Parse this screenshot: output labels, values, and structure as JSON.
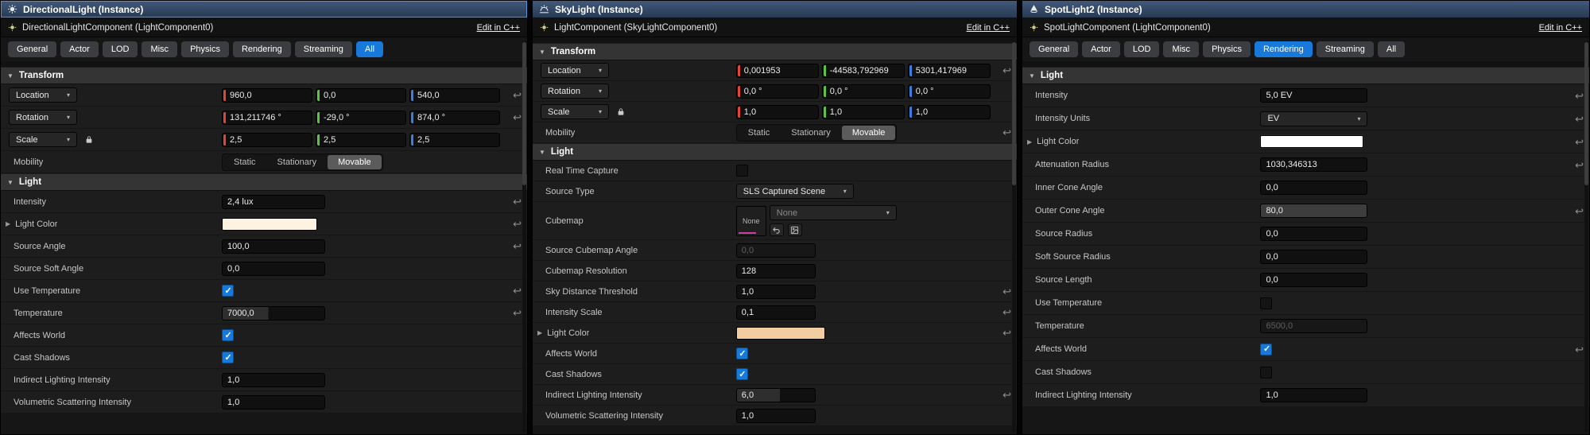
{
  "colors": {
    "accent": "#1779da",
    "axis_x": "#e0453a",
    "axis_y": "#5ec440",
    "axis_z": "#3a7ce0",
    "p1_light_color": "#fdf3e0",
    "p2_light_color": "#f2cda1",
    "p3_light_color": "#ffffff"
  },
  "icons": {
    "chevron_down": "▾",
    "section_collapse": "▼",
    "row_expand": "▶",
    "reset": "↩"
  },
  "panels": [
    {
      "title": "DirectionalLight (Instance)",
      "component": "DirectionalLightComponent (LightComponent0)",
      "edit_link": "Edit in C++",
      "tabs": [
        {
          "label": "General",
          "active": false
        },
        {
          "label": "Actor",
          "active": false
        },
        {
          "label": "LOD",
          "active": false
        },
        {
          "label": "Misc",
          "active": false
        },
        {
          "label": "Physics",
          "active": false
        },
        {
          "label": "Rendering",
          "active": false
        },
        {
          "label": "Streaming",
          "active": false
        },
        {
          "label": "All",
          "active": true
        }
      ],
      "transform_header": "Transform",
      "transform": {
        "location": {
          "label": "Location",
          "x": "960,0",
          "y": "0,0",
          "z": "540,0"
        },
        "rotation": {
          "label": "Rotation",
          "x": "131,211746 °",
          "y": "-29,0 °",
          "z": "874,0 °"
        },
        "scale": {
          "label": "Scale",
          "x": "2,5",
          "y": "2,5",
          "z": "2,5"
        },
        "mobility": {
          "label": "Mobility",
          "options": [
            {
              "label": "Static",
              "active": false
            },
            {
              "label": "Stationary",
              "active": false
            },
            {
              "label": "Movable",
              "active": true
            }
          ]
        }
      },
      "light_header": "Light",
      "light": {
        "intensity": {
          "label": "Intensity",
          "value": "2,4 lux"
        },
        "light_color": {
          "label": "Light Color"
        },
        "source_angle": {
          "label": "Source Angle",
          "value": "100,0"
        },
        "source_soft_angle": {
          "label": "Source Soft Angle",
          "value": "0,0"
        },
        "use_temperature": {
          "label": "Use Temperature",
          "checked": true
        },
        "temperature": {
          "label": "Temperature",
          "value": "7000,0"
        },
        "affects_world": {
          "label": "Affects World",
          "checked": true
        },
        "cast_shadows": {
          "label": "Cast Shadows",
          "checked": true
        },
        "indirect_lighting_intensity": {
          "label": "Indirect Lighting Intensity",
          "value": "1,0"
        },
        "volumetric_scattering_intensity": {
          "label": "Volumetric Scattering Intensity",
          "value": "1,0"
        }
      }
    },
    {
      "title": "SkyLight (Instance)",
      "component": "LightComponent (SkyLightComponent0)",
      "edit_link": "Edit in C++",
      "transform_header": "Transform",
      "transform": {
        "location": {
          "label": "Location",
          "x": "0,001953",
          "y": "-44583,792969",
          "z": "5301,417969"
        },
        "rotation": {
          "label": "Rotation",
          "x": "0,0 °",
          "y": "0,0 °",
          "z": "0,0 °"
        },
        "scale": {
          "label": "Scale",
          "x": "1,0",
          "y": "1,0",
          "z": "1,0"
        },
        "mobility": {
          "label": "Mobility",
          "options": [
            {
              "label": "Static",
              "active": false
            },
            {
              "label": "Stationary",
              "active": false
            },
            {
              "label": "Movable",
              "active": true
            }
          ]
        }
      },
      "light_header": "Light",
      "light": {
        "real_time_capture": {
          "label": "Real Time Capture",
          "checked": false
        },
        "source_type": {
          "label": "Source Type",
          "value": "SLS Captured Scene"
        },
        "cubemap": {
          "label": "Cubemap",
          "thumb": "None",
          "value": "None"
        },
        "source_cubemap_angle": {
          "label": "Source Cubemap Angle",
          "value": "0,0"
        },
        "cubemap_resolution": {
          "label": "Cubemap Resolution",
          "value": "128"
        },
        "sky_distance_threshold": {
          "label": "Sky Distance Threshold",
          "value": "1,0"
        },
        "intensity_scale": {
          "label": "Intensity Scale",
          "value": "0,1"
        },
        "light_color": {
          "label": "Light Color"
        },
        "affects_world": {
          "label": "Affects World",
          "checked": true
        },
        "cast_shadows": {
          "label": "Cast Shadows",
          "checked": true
        },
        "indirect_lighting_intensity": {
          "label": "Indirect Lighting Intensity",
          "value": "6,0"
        },
        "volumetric_scattering_intensity": {
          "label": "Volumetric Scattering Intensity",
          "value": "1,0"
        }
      }
    },
    {
      "title": "SpotLight2 (Instance)",
      "component": "SpotLightComponent (LightComponent0)",
      "edit_link": "Edit in C++",
      "tabs": [
        {
          "label": "General",
          "active": false
        },
        {
          "label": "Actor",
          "active": false
        },
        {
          "label": "LOD",
          "active": false
        },
        {
          "label": "Misc",
          "active": false
        },
        {
          "label": "Physics",
          "active": false
        },
        {
          "label": "Rendering",
          "active": true
        },
        {
          "label": "Streaming",
          "active": false
        },
        {
          "label": "All",
          "active": false
        }
      ],
      "light_header": "Light",
      "light": {
        "intensity": {
          "label": "Intensity",
          "value": "5,0 EV"
        },
        "intensity_units": {
          "label": "Intensity Units",
          "value": "EV"
        },
        "light_color": {
          "label": "Light Color"
        },
        "attenuation_radius": {
          "label": "Attenuation Radius",
          "value": "1030,346313"
        },
        "inner_cone_angle": {
          "label": "Inner Cone Angle",
          "value": "0,0"
        },
        "outer_cone_angle": {
          "label": "Outer Cone Angle",
          "value": "80,0"
        },
        "source_radius": {
          "label": "Source Radius",
          "value": "0,0"
        },
        "soft_source_radius": {
          "label": "Soft Source Radius",
          "value": "0,0"
        },
        "source_length": {
          "label": "Source Length",
          "value": "0,0"
        },
        "use_temperature": {
          "label": "Use Temperature",
          "checked": false
        },
        "temperature": {
          "label": "Temperature",
          "value": "6500,0"
        },
        "affects_world": {
          "label": "Affects World",
          "checked": true
        },
        "cast_shadows": {
          "label": "Cast Shadows",
          "checked": false
        },
        "indirect_lighting_intensity": {
          "label": "Indirect Lighting Intensity",
          "value": "1,0"
        }
      }
    }
  ]
}
